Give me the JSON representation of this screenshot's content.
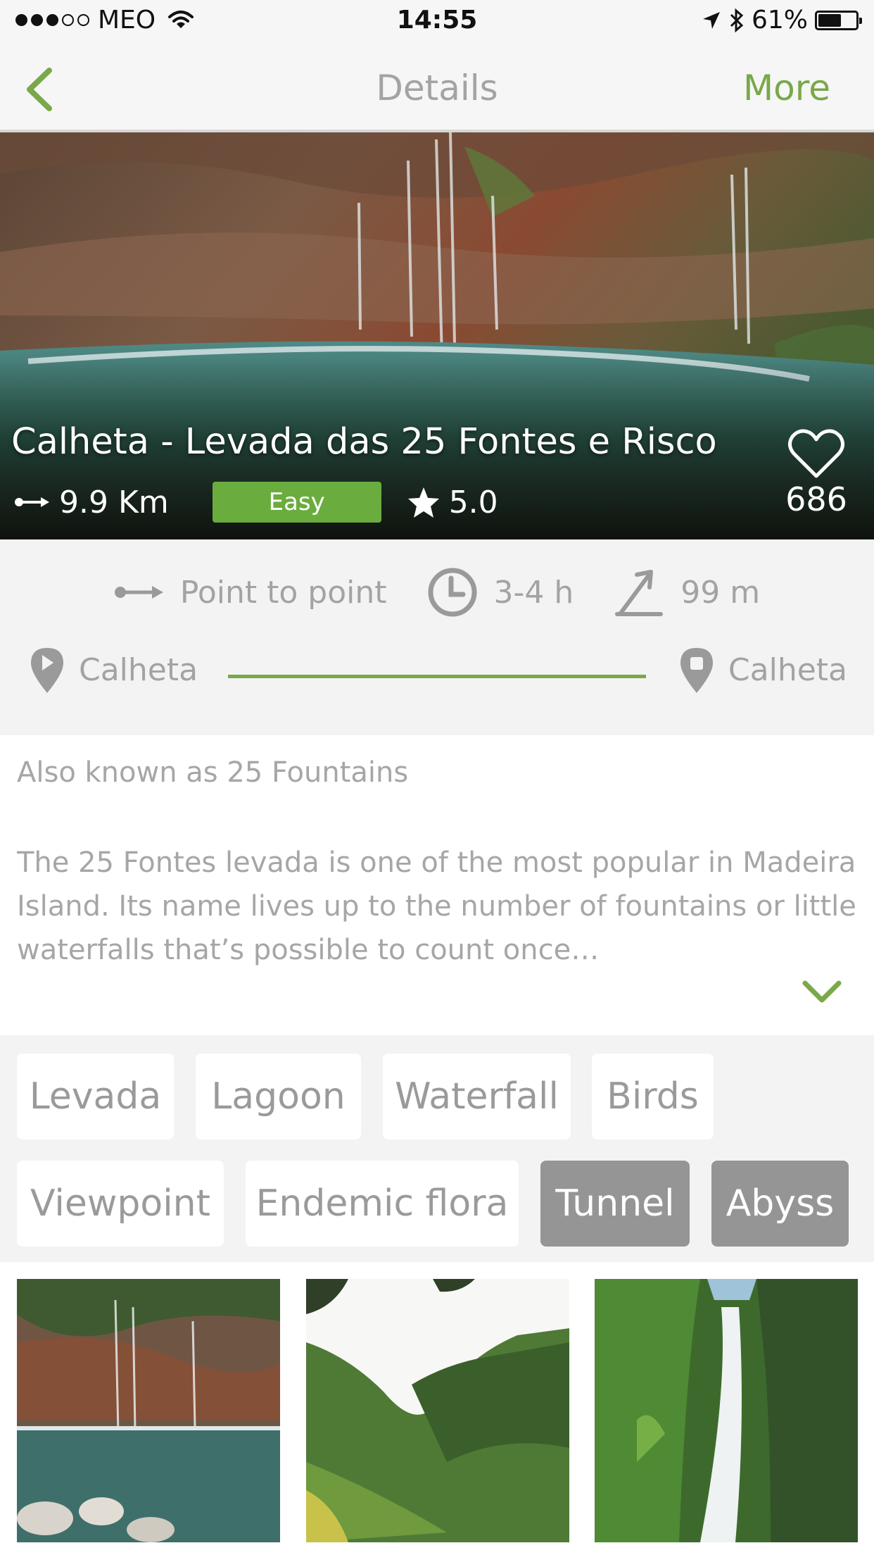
{
  "status_bar": {
    "carrier": "MEO",
    "time": "14:55",
    "battery": "61%",
    "battery_level": 0.61
  },
  "nav": {
    "title": "Details",
    "more_label": "More"
  },
  "hero": {
    "title": "Calheta - Levada das 25 Fontes e Risco",
    "distance": "9.9 Km",
    "difficulty": "Easy",
    "rating": "5.0",
    "likes": "686"
  },
  "stats": {
    "route_type": "Point to point",
    "duration": "3-4 h",
    "elevation": "99 m",
    "start": "Calheta",
    "end": "Calheta"
  },
  "description": {
    "subtitle": "Also known as 25 Fountains",
    "body": "The 25 Fontes levada is one of the most popular in Madeira Island. Its name lives up to the number of fountains or little waterfalls that’s possible to count once…"
  },
  "tags": [
    {
      "label": "Levada",
      "active": false
    },
    {
      "label": "Lagoon",
      "active": false
    },
    {
      "label": "Waterfall",
      "active": false
    },
    {
      "label": "Birds",
      "active": false
    },
    {
      "label": "Viewpoint",
      "active": false
    },
    {
      "label": "Endemic flora",
      "active": false
    },
    {
      "label": "Tunnel",
      "active": true
    },
    {
      "label": "Abyss",
      "active": true
    }
  ],
  "colors": {
    "accent": "#7aa84a",
    "difficulty_easy": "#6aad3e",
    "active_tag": "#959595"
  }
}
